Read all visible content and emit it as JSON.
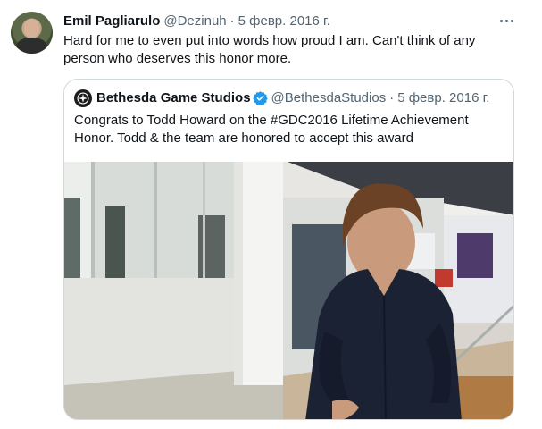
{
  "tweet": {
    "author_name": "Emil Pagliarulo",
    "author_handle": "@Dezinuh",
    "separator": "·",
    "date": "5 февр. 2016 г.",
    "text": "Hard for me to even put into words how proud I am. Can't think of any person who deserves this honor more.",
    "avatar_icon": "user-avatar",
    "more_icon": "more-dots-icon"
  },
  "quoted": {
    "author_name": "Bethesda Game Studios",
    "verified_icon": "verified-badge-icon",
    "author_handle": "@BethesdaStudios",
    "separator": "·",
    "date": "5 февр. 2016 г.",
    "text": "Congrats to Todd Howard on the #GDC2016 Lifetime Achievement Honor. Todd & the team are honored to accept this award",
    "media_description": "photo"
  },
  "colors": {
    "text_primary": "#0f1419",
    "text_secondary": "#536471",
    "border": "#cfd9de",
    "verified_blue": "#1d9bf0"
  }
}
